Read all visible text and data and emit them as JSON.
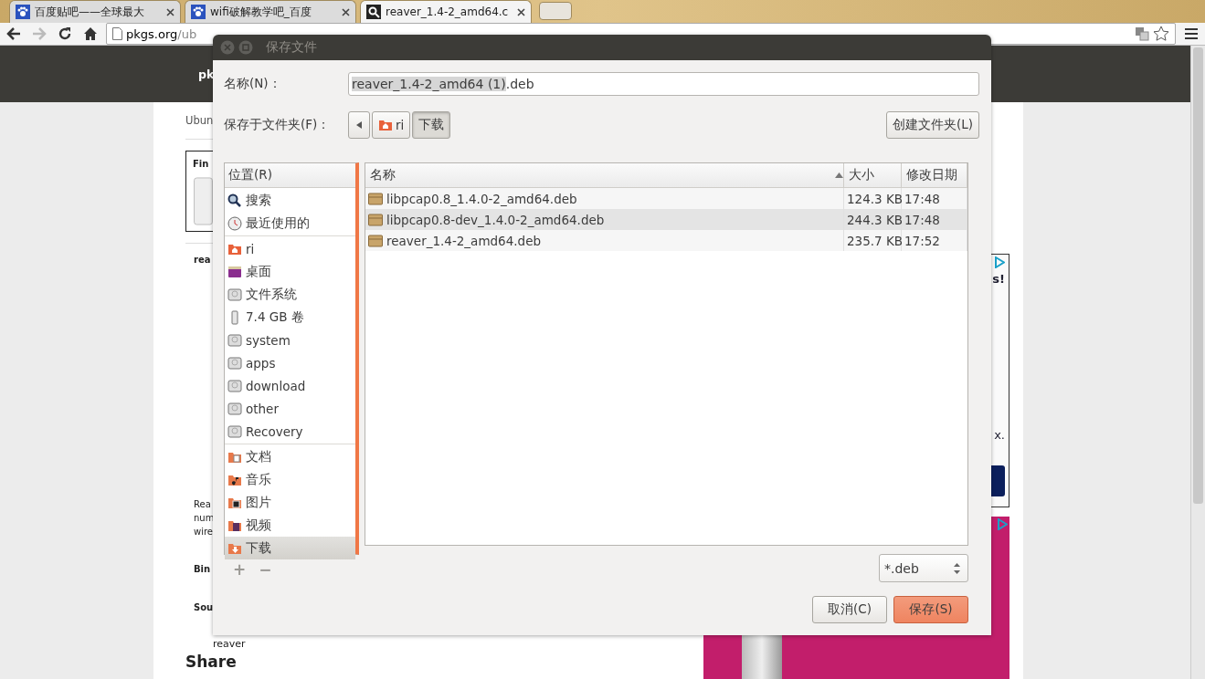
{
  "browser": {
    "tabs": [
      {
        "title": "百度贴吧——全球最大",
        "selected": false
      },
      {
        "title": "wifi破解教学吧_百度",
        "selected": false
      },
      {
        "title": "reaver_1.4-2_amd64.c",
        "selected": true
      }
    ],
    "url_host": "pkgs.org",
    "url_path": "/ub",
    "forward_disabled": true
  },
  "page": {
    "header_text": "pk",
    "left_fragments": [
      {
        "kind": "crumb",
        "text": "Ubun"
      },
      {
        "kind": "box",
        "text": "Fin"
      },
      {
        "kind": "heading",
        "text": "rea"
      },
      {
        "kind": "para",
        "text": "Rea"
      },
      {
        "kind": "body",
        "text": "num"
      },
      {
        "kind": "body",
        "text": "wire"
      },
      {
        "kind": "section",
        "text": "Bin"
      },
      {
        "kind": "section",
        "text": "Sou"
      },
      {
        "kind": "link",
        "text": "reaver"
      },
      {
        "kind": "share",
        "text": "Share"
      }
    ],
    "ad_fragments": [
      "s!",
      "x."
    ]
  },
  "dialog": {
    "title": "保存文件",
    "name_label": "名称(N)：",
    "name_selected": "reaver_1.4-2_amd64 (1)",
    "name_rest": ".deb",
    "folder_label": "保存于文件夹(F)：",
    "path": [
      {
        "label": "ri",
        "selected": false
      },
      {
        "label": "下载",
        "selected": true
      }
    ],
    "create_folder": "创建文件夹(L)",
    "places_header": "位置(R)",
    "places": [
      [
        {
          "label": "搜索",
          "kind": "search",
          "selected": false
        },
        {
          "label": "最近使用的",
          "kind": "recent",
          "selected": false
        }
      ],
      [
        {
          "label": "ri",
          "kind": "home",
          "selected": false
        },
        {
          "label": "桌面",
          "kind": "desktop",
          "selected": false
        },
        {
          "label": "文件系统",
          "kind": "drive",
          "selected": false
        },
        {
          "label": "7.4 GB 卷",
          "kind": "usb",
          "selected": false
        },
        {
          "label": "system",
          "kind": "drive",
          "selected": false
        },
        {
          "label": "apps",
          "kind": "drive",
          "selected": false
        },
        {
          "label": "download",
          "kind": "drive",
          "selected": false
        },
        {
          "label": "other",
          "kind": "drive",
          "selected": false
        },
        {
          "label": "Recovery",
          "kind": "drive",
          "selected": false
        }
      ],
      [
        {
          "label": "文档",
          "kind": "documents",
          "selected": false
        },
        {
          "label": "音乐",
          "kind": "music",
          "selected": false
        },
        {
          "label": "图片",
          "kind": "pictures",
          "selected": false
        },
        {
          "label": "视频",
          "kind": "videos",
          "selected": false
        },
        {
          "label": "下载",
          "kind": "downloads",
          "selected": true
        }
      ]
    ],
    "add_label": "+",
    "remove_label": "−",
    "add_remove_disabled": true,
    "columns": [
      "名称",
      "大小",
      "修改日期"
    ],
    "files": [
      {
        "name": "libpcap0.8_1.4.0-2_amd64.deb",
        "size": "124.3 KB",
        "modified": "17:48",
        "selected": false
      },
      {
        "name": "libpcap0.8-dev_1.4.0-2_amd64.deb",
        "size": "244.3 KB",
        "modified": "17:48",
        "selected": true
      },
      {
        "name": "reaver_1.4-2_amd64.deb",
        "size": "235.7 KB",
        "modified": "17:52",
        "selected": false
      }
    ],
    "filter": "*.deb",
    "cancel": "取消(C)",
    "save": "保存(S)"
  }
}
